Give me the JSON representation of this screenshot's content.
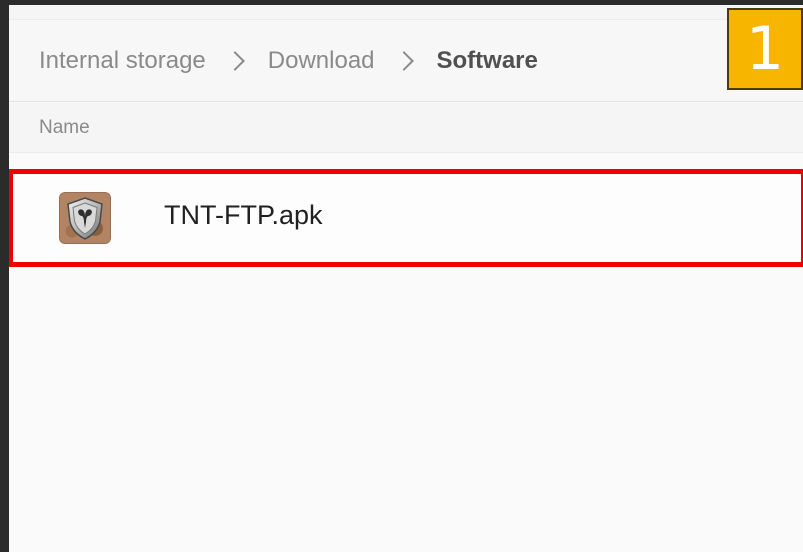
{
  "breadcrumb": {
    "items": [
      {
        "label": "Internal storage"
      },
      {
        "label": "Download"
      },
      {
        "label": "Software"
      }
    ]
  },
  "columns": {
    "name_label": "Name"
  },
  "files": [
    {
      "name": "TNT-FTP.apk",
      "icon": "apk-shield-icon"
    }
  ],
  "annotation": {
    "step_label": "1",
    "highlight_color": "#ee0000",
    "badge_color": "#f7b500"
  }
}
